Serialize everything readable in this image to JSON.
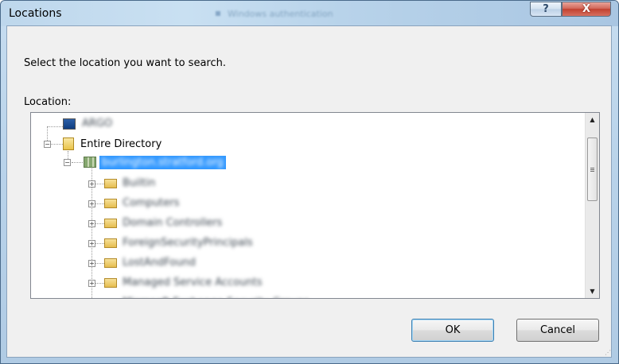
{
  "window": {
    "title": "Locations",
    "background_title": "Windows authentication",
    "help_label": "?",
    "close_label": "X"
  },
  "dialog": {
    "prompt": "Select the location you want to search.",
    "location_label": "Location:"
  },
  "tree": {
    "root_computer": "ARGO",
    "entire_directory": "Entire Directory",
    "domain": "burlington.stratford.org",
    "containers": [
      "Builtin",
      "Computers",
      "Domain Controllers",
      "ForeignSecurityPrincipals",
      "LostAndFound",
      "Managed Service Accounts",
      "Microsoft Exchange Security Groups"
    ]
  },
  "buttons": {
    "ok": "OK",
    "cancel": "Cancel"
  },
  "colors": {
    "selection": "#3399ff",
    "client_bg": "#f0f0f0",
    "frame": "#b9d3ea"
  }
}
